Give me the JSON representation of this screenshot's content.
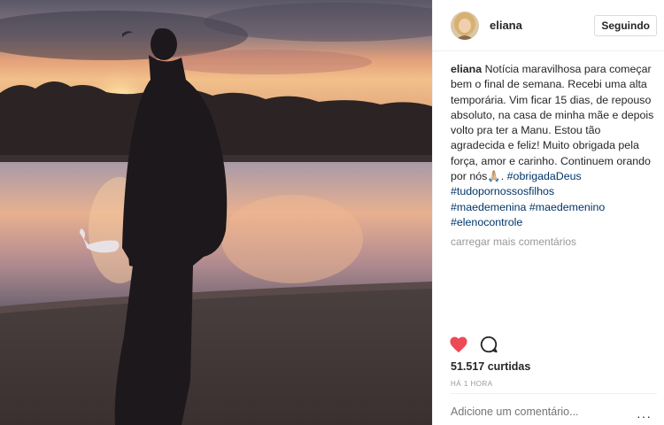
{
  "post": {
    "username": "eliana",
    "follow_label": "Seguindo",
    "caption_user": "eliana",
    "caption_text": "Notícia maravilhosa para começar bem o final de semana. Recebi uma alta temporária. Vim ficar 15 dias, de repouso absoluto, na casa de minha mãe e depois volto pra ter a Manu. Estou tão agradecida e feliz! Muito obrigada pela força, amor e carinho. Continuem orando por nós🙏🏼.",
    "tags_inline": "#obrigadaDeus #tudopornossosfilhos",
    "tags": [
      "#maedemenina #maedemenino",
      "#elenocontrole"
    ],
    "load_more": "carregar mais comentários",
    "likes": "51.517 curtidas",
    "time": "HÁ 1 HORA",
    "comment_placeholder": "Adicione um comentário...",
    "more_icon": "···"
  },
  "icons": {
    "like": "heart-icon",
    "comment": "comment-icon",
    "more": "more-options-icon"
  },
  "colors": {
    "like_red": "#ed4956",
    "tag_blue": "#003569",
    "muted": "#999999"
  }
}
